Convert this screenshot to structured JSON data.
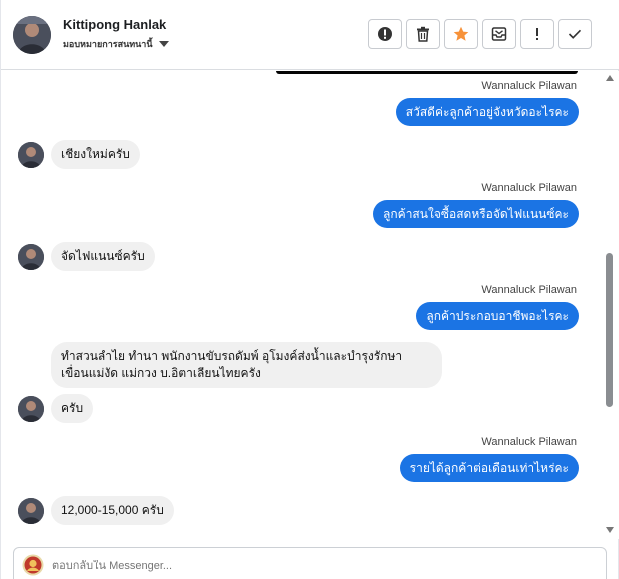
{
  "header": {
    "name": "Kittipong Hanlak",
    "status": "มอบหมายการสนทนานี้",
    "toolbar": [
      {
        "icon": "alert-circle-icon"
      },
      {
        "icon": "trash-icon"
      },
      {
        "icon": "star-icon",
        "color": "#f7923a"
      },
      {
        "icon": "mail-archive-icon"
      },
      {
        "icon": "exclamation-icon"
      },
      {
        "icon": "checkmark-icon"
      }
    ]
  },
  "thread": {
    "messages": [
      {
        "dir": "out",
        "sender": "Wannaluck Pilawan",
        "text": "สวัสดีค่ะลูกค้าอยู่จังหวัดอะไรคะ"
      },
      {
        "dir": "in",
        "text": "เชียงใหม่ครับ"
      },
      {
        "dir": "out",
        "sender": "Wannaluck Pilawan",
        "text": "ลูกค้าสนใจซื้อสดหรือจัดไฟแนนซ์คะ"
      },
      {
        "dir": "in",
        "text": "จัดไฟแนนซ์ครับ"
      },
      {
        "dir": "out",
        "sender": "Wannaluck Pilawan",
        "text": "ลูกค้าประกอบอาชีพอะไรคะ"
      },
      {
        "dir": "in",
        "lines": [
          "ทำสวนลำไย ทำนา พนักงานขับรถดัมพ์ อุโมงค์ส่งน้ำและบำรุงรักษา",
          "เขื่อนแม่งัด แม่กวง บ.อิตาเลียนไทยครัง"
        ]
      },
      {
        "dir": "in",
        "text": "ครับ"
      },
      {
        "dir": "out",
        "sender": "Wannaluck Pilawan",
        "text": "รายได้ลูกค้าต่อเดือนเท่าไหร่คะ"
      },
      {
        "dir": "in",
        "text": "12,000-15,000 ครับ"
      }
    ]
  },
  "composer": {
    "placeholder": "ตอบกลับใน Messenger..."
  },
  "colors": {
    "outgoing_bubble": "#1b74e4",
    "incoming_bubble": "#f0f0f0",
    "star": "#f7923a"
  }
}
